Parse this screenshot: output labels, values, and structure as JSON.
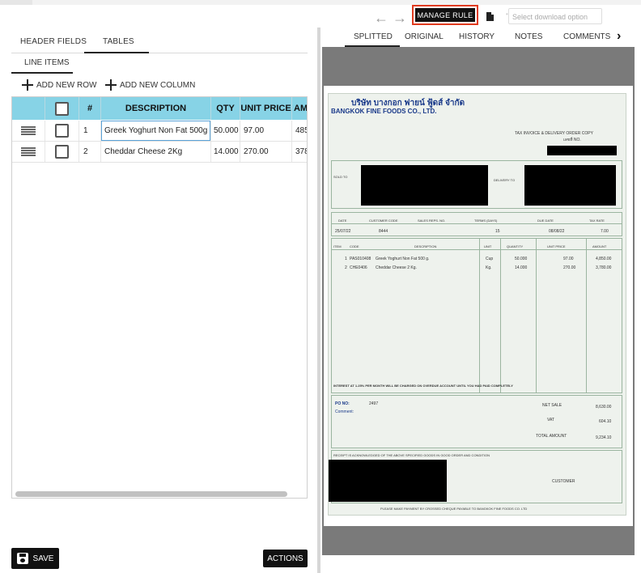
{
  "left_panel": {
    "tabs": [
      "HEADER FIELDS",
      "TABLES"
    ],
    "active_tab": "TABLES",
    "subtab": "LINE ITEMS",
    "add_row": "ADD NEW ROW",
    "add_column": "ADD NEW COLUMN",
    "grid": {
      "columns": [
        "#",
        "DESCRIPTION",
        "QTY",
        "UNIT PRICE",
        "AMO"
      ],
      "rows": [
        {
          "num": "1",
          "description": "Greek Yoghurt Non Fat 500g",
          "qty": "50.000",
          "unit_price": "97.00",
          "amount": "485"
        },
        {
          "num": "2",
          "description": "Cheddar Cheese 2Kg",
          "qty": "14.000",
          "unit_price": "270.00",
          "amount": "378"
        }
      ]
    },
    "save": "SAVE",
    "actions": "ACTIONS"
  },
  "right_panel": {
    "manage_rule": "MANAGE RULE",
    "select_placeholder": "Select download option",
    "tabs": [
      "SPLITTED",
      "ORIGINAL",
      "HISTORY",
      "NOTES",
      "COMMENTS"
    ],
    "active_tab": "SPLITTED",
    "document": {
      "company_thai": "บริษัท บางกอก ฟายน์ ฟู้ดส์ จำกัด",
      "company_en": "BANGKOK FINE FOODS CO., LTD.",
      "doc_title_1": "TAX INVOICE & DELIVERY ORDER COPY",
      "doc_no_label": "เลขที่ NO.",
      "sold_to": "SOLD TO",
      "delivery_to": "DELIVERY TO",
      "header_labels": [
        "DATE",
        "CUSTOMER CODE",
        "SALES REPS. NO.",
        "TERMS (DAYS)",
        "DUE DATE",
        "TAX RATE"
      ],
      "header_values": [
        "25/07/22",
        "8444",
        "15",
        "08/08/22",
        "7.00"
      ],
      "line_labels": [
        "ITEM",
        "CODE",
        "DESCRIPTION",
        "UNIT",
        "QUANTITY",
        "UNIT PRICE",
        "AMOUNT"
      ],
      "lines": [
        {
          "item": "1",
          "code": "PAS010408",
          "desc": "Greek Yoghurt Non Fat 500 g.",
          "unit": "Cup",
          "qty": "50.000",
          "price": "97.00",
          "amount": "4,850.00"
        },
        {
          "item": "2",
          "code": "CHE0406",
          "desc": "Cheddar Cheese 2 Kg.",
          "unit": "Kg.",
          "qty": "14.000",
          "price": "270.00",
          "amount": "3,780.00"
        }
      ],
      "interest_note": "INTEREST AT 1.25% PER MONTH WILL BE CHARGED ON OVERDUE ACCOUNT UNTIL YOU HAD PAID COMPLETELY",
      "po_label": "PO NO:",
      "po_value": "2497",
      "comment_label": "Comment:",
      "net_sale_label": "NET SALE",
      "net_sale": "8,630.00",
      "vat_label": "VAT",
      "vat": "604.10",
      "total_label": "TOTAL AMOUNT",
      "total": "9,234.10",
      "receipt_note": "RECEIPT IS ACKNOWLEDGED OF THE ABOVE SPECIFIED GOODS IN GOOD ORDER AND CONDITION",
      "customer": "CUSTOMER",
      "cheque_note": "PLEASE MAKE PAYMENT BY CROSSED CHEQUE PAYABLE TO BANGKOK FINE FOODS CO. LTD"
    }
  }
}
